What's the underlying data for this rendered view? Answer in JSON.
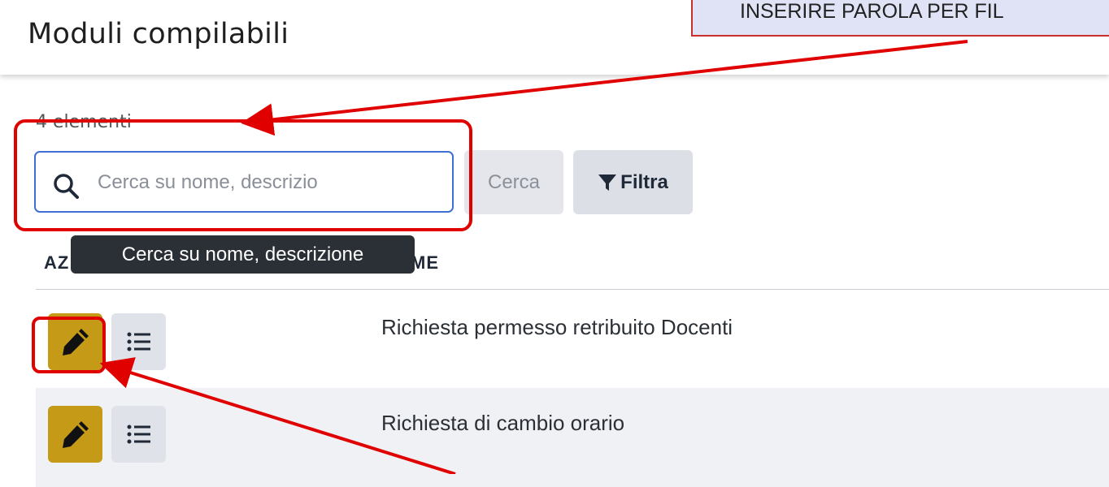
{
  "header": {
    "title": "Moduli compilabili"
  },
  "annotation": {
    "callout_text": "INSERIRE PAROLA PER FIL"
  },
  "list": {
    "count_label": "4 elementi"
  },
  "search": {
    "placeholder": "Cerca su nome, descrizio",
    "value": "",
    "tooltip": "Cerca su nome, descrizione",
    "search_button": "Cerca",
    "filter_button": "Filtra"
  },
  "table": {
    "columns": [
      "AZ",
      "ME"
    ],
    "rows": [
      {
        "title": "Richiesta permesso retribuito Docenti"
      },
      {
        "title": "Richiesta di cambio orario"
      }
    ]
  },
  "icons": {
    "search": "search-icon",
    "filter": "filter-icon",
    "edit": "pencil-icon",
    "details": "list-icon"
  },
  "colors": {
    "edit_button": "#c49a17",
    "search_border": "#3f6fd1",
    "annotation_red": "#e00000"
  }
}
